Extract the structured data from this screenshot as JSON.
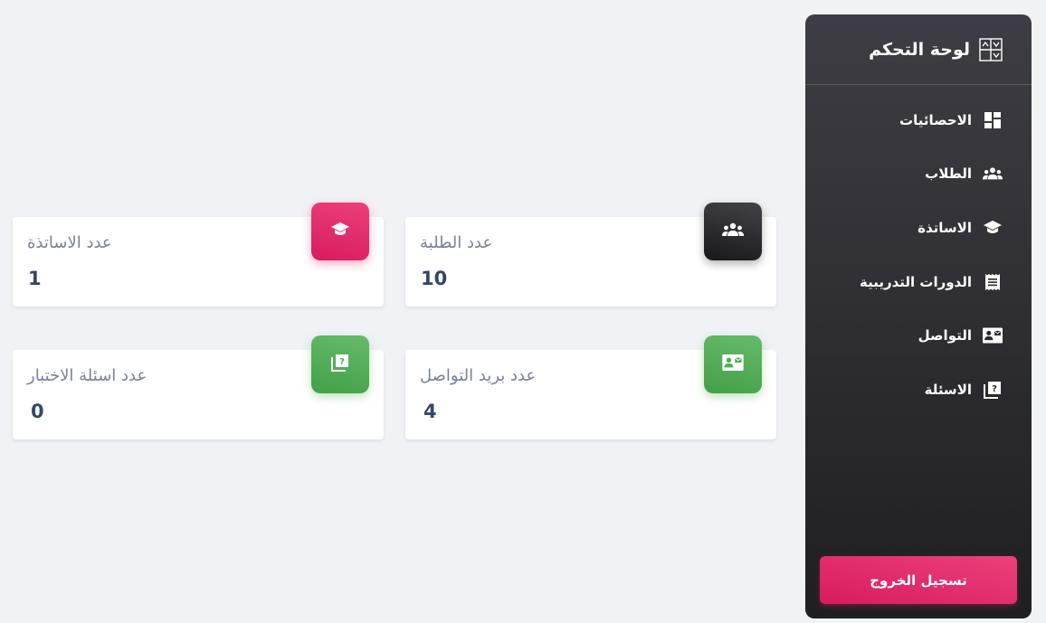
{
  "sidebar": {
    "title": "لوحة التحكم",
    "brand_icon": "dashboard-icon",
    "items": [
      {
        "label": "الاحصائيات",
        "icon": "dashboard-grid-icon"
      },
      {
        "label": "الطلاب",
        "icon": "groups-icon"
      },
      {
        "label": "الاساتذة",
        "icon": "school-icon"
      },
      {
        "label": "الدورات التدريبية",
        "icon": "receipt-icon"
      },
      {
        "label": "التواصل",
        "icon": "contact-mail-icon"
      },
      {
        "label": "الاسئلة",
        "icon": "quiz-icon"
      }
    ],
    "logout_label": "تسجيل الخروج"
  },
  "cards": {
    "students": {
      "label": "عدد الطلبة",
      "value": "10",
      "icon": "groups-icon"
    },
    "teachers": {
      "label": "عدد الاساتذة",
      "value": "1",
      "icon": "school-icon"
    },
    "contact": {
      "label": "عدد بريد التواصل",
      "value": "4",
      "icon": "contact-mail-icon"
    },
    "questions": {
      "label": "عدد اسئلة الاختبار",
      "value": "0",
      "icon": "quiz-icon"
    }
  },
  "colors": {
    "background": "#f0f2f5",
    "sidebar_dark": "#3e3d45",
    "accent_pink": "#e91e63",
    "accent_green": "#4caf50",
    "text_value": "#344767",
    "text_label": "#7b809a"
  }
}
